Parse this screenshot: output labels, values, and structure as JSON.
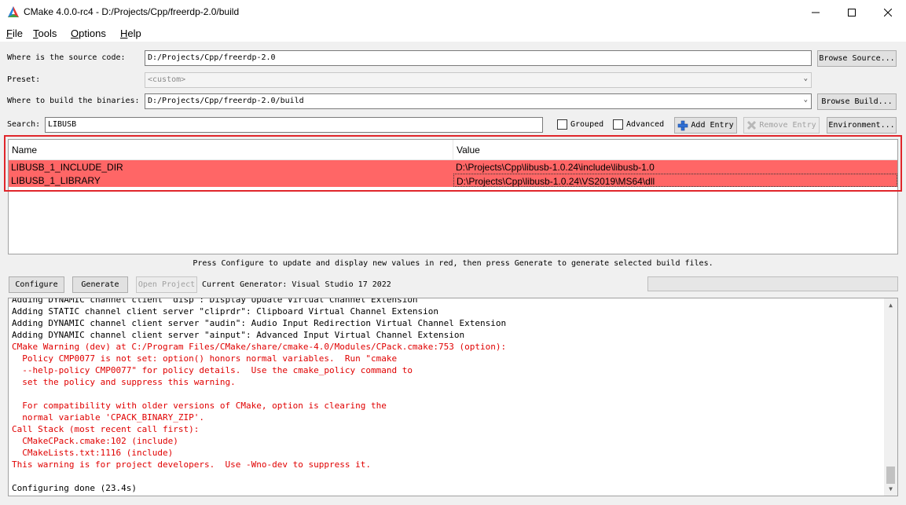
{
  "window": {
    "title": "CMake 4.0.0-rc4 - D:/Projects/Cpp/freerdp-2.0/build",
    "icon": "cmake-triangle-icon",
    "controls": [
      "minimize-icon",
      "maximize-icon",
      "close-icon"
    ]
  },
  "menu": {
    "items": [
      {
        "key": "F",
        "rest": "ile"
      },
      {
        "key": "T",
        "rest": "ools"
      },
      {
        "key": "O",
        "rest": "ptions"
      },
      {
        "key": "H",
        "rest": "elp"
      }
    ]
  },
  "source": {
    "label": "Where is the source code:",
    "value": "D:/Projects/Cpp/freerdp-2.0",
    "button": "Browse Source..."
  },
  "preset": {
    "label": "Preset:",
    "value": "<custom>"
  },
  "build": {
    "label": "Where to build the binaries:",
    "value": "D:/Projects/Cpp/freerdp-2.0/build",
    "button": "Browse Build..."
  },
  "search": {
    "label": "Search:",
    "value": "LIBUSB",
    "grouped_label": "Grouped",
    "grouped_checked": false,
    "advanced_label": "Advanced",
    "advanced_checked": false,
    "add_entry": "Add Entry",
    "remove_entry": "Remove Entry",
    "environment": "Environment..."
  },
  "table": {
    "columns": [
      "Name",
      "Value"
    ],
    "rows": [
      {
        "name": "LIBUSB_1_INCLUDE_DIR",
        "value": "D:\\Projects\\Cpp\\libusb-1.0.24\\include\\libusb-1.0"
      },
      {
        "name": "LIBUSB_1_LIBRARY",
        "value": "D:\\Projects\\Cpp\\libusb-1.0.24\\VS2019\\MS64\\dll"
      }
    ],
    "highlight_color": "#ff6666"
  },
  "hint": "Press Configure to update and display new values in red, then press Generate to generate selected build files.",
  "actions": {
    "configure": "Configure",
    "generate": "Generate",
    "open_project": "Open Project",
    "generator": "Current Generator: Visual Studio 17 2022"
  },
  "output": {
    "lines": [
      {
        "text": "Adding DYNAMIC channel client \"disp\": Display Update Virtual Channel Extension",
        "red": false
      },
      {
        "text": "Adding STATIC channel client server \"cliprdr\": Clipboard Virtual Channel Extension",
        "red": false
      },
      {
        "text": "Adding DYNAMIC channel client server \"audin\": Audio Input Redirection Virtual Channel Extension",
        "red": false
      },
      {
        "text": "Adding DYNAMIC channel client server \"ainput\": Advanced Input Virtual Channel Extension",
        "red": false
      },
      {
        "text": "CMake Warning (dev) at C:/Program Files/CMake/share/cmake-4.0/Modules/CPack.cmake:753 (option):",
        "red": true
      },
      {
        "text": "  Policy CMP0077 is not set: option() honors normal variables.  Run \"cmake",
        "red": true
      },
      {
        "text": "  --help-policy CMP0077\" for policy details.  Use the cmake_policy command to",
        "red": true
      },
      {
        "text": "  set the policy and suppress this warning.",
        "red": true
      },
      {
        "text": "",
        "red": true
      },
      {
        "text": "  For compatibility with older versions of CMake, option is clearing the",
        "red": true
      },
      {
        "text": "  normal variable 'CPACK_BINARY_ZIP'.",
        "red": true
      },
      {
        "text": "Call Stack (most recent call first):",
        "red": true
      },
      {
        "text": "  CMakeCPack.cmake:102 (include)",
        "red": true
      },
      {
        "text": "  CMakeLists.txt:1116 (include)",
        "red": true
      },
      {
        "text": "This warning is for project developers.  Use -Wno-dev to suppress it.",
        "red": true
      },
      {
        "text": "",
        "red": false
      },
      {
        "text": "Configuring done (23.4s)",
        "red": false
      }
    ],
    "warning_color": "#e00000"
  },
  "annotation": {
    "color": "#e0262b"
  }
}
